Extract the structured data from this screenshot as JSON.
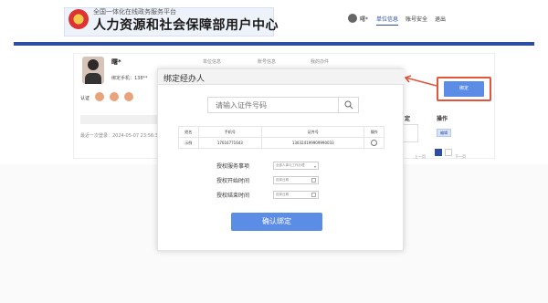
{
  "header": {
    "subtitle": "全国一体化在线政务服务平台",
    "title": "人力资源和社会保障部用户中心",
    "user_name": "曙*",
    "nav": [
      "单位信息",
      "账号安全",
      "退出"
    ]
  },
  "background": {
    "name": "曙*",
    "phone": "绑定手机：138**",
    "tabs": [
      "单位信息",
      "账号信息",
      "我的办件"
    ],
    "auth_label": "认证",
    "last_login": "最近一次登录：2024-05-07 23:56:38",
    "right_header": "操作",
    "right_header2": "定",
    "right_action": "编辑",
    "pager_prev": "上一页",
    "pager_next": "下一页",
    "annotated_button": "绑定"
  },
  "modal": {
    "title": "绑定经办人",
    "search_placeholder": "请输入证件号码",
    "table": {
      "headers": [
        "姓名",
        "手机号",
        "证件号",
        "操作"
      ],
      "rows": [
        {
          "name": "示例",
          "phone": "17616771643",
          "id_no": "130324199909990033"
        }
      ]
    },
    "form": {
      "service_label": "授权服务事项",
      "service_value": "全部人事与工作办理",
      "start_label": "授权开始时间",
      "start_placeholder": "选择日期",
      "end_label": "授权结束时间",
      "end_placeholder": "选择日期"
    },
    "confirm": "确认绑定"
  },
  "colors": {
    "primary": "#2c4da0",
    "button": "#5b8de6",
    "annotation": "#e0553c"
  }
}
